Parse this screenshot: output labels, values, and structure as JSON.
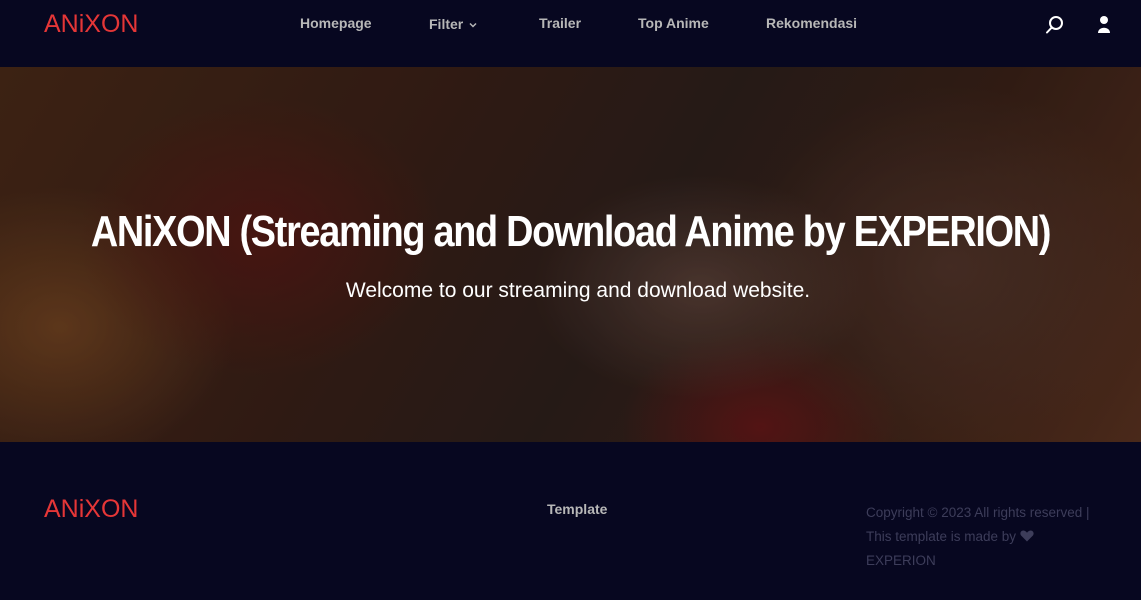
{
  "brand": {
    "logo_text": "ANiXON",
    "accent_color": "#e53637"
  },
  "nav": {
    "items": [
      {
        "label": "Homepage"
      },
      {
        "label": "Filter",
        "has_dropdown": true
      },
      {
        "label": "Trailer"
      },
      {
        "label": "Top Anime"
      },
      {
        "label": "Rekomendasi"
      }
    ],
    "icons": [
      "search-icon",
      "user-icon"
    ]
  },
  "hero": {
    "title": "ANiXON (Streaming and Download Anime by EXPERION)",
    "subtitle": "Welcome to our streaming and download website."
  },
  "footer": {
    "logo_text": "ANiXON",
    "link_label": "Template",
    "copyright_line1": "Copyright © 2023 All rights reserved |",
    "copyright_line2": "This template is made by",
    "copyright_author": "EXPERION"
  }
}
